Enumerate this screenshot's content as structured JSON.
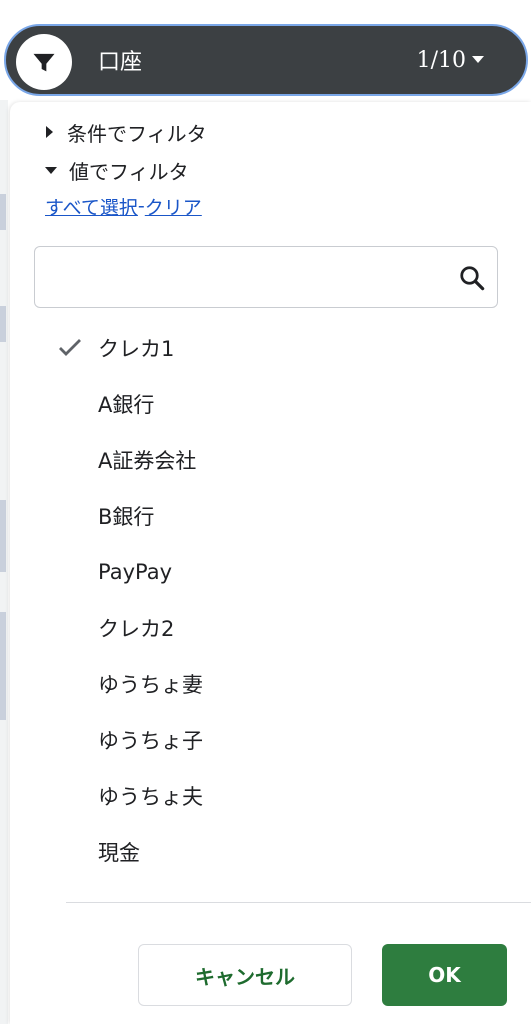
{
  "header": {
    "column_name": "口座",
    "counter": "1/10",
    "filter_icon": "filter-icon"
  },
  "filter_menu": {
    "by_condition_label": "条件でフィルタ",
    "by_value_label": "値でフィルタ",
    "select_all_label": "すべて選択",
    "separator": "-",
    "clear_label": "クリア",
    "search": {
      "value": "",
      "placeholder": "",
      "icon": "search-icon"
    },
    "values": [
      {
        "label": "クレカ1",
        "checked": true
      },
      {
        "label": "A銀行",
        "checked": false
      },
      {
        "label": "A証券会社",
        "checked": false
      },
      {
        "label": "B銀行",
        "checked": false
      },
      {
        "label": "PayPay",
        "checked": false
      },
      {
        "label": "クレカ2",
        "checked": false
      },
      {
        "label": "ゆうちょ妻",
        "checked": false
      },
      {
        "label": "ゆうちょ子",
        "checked": false
      },
      {
        "label": "ゆうちょ夫",
        "checked": false
      },
      {
        "label": "現金",
        "checked": false
      }
    ],
    "cancel_label": "キャンセル",
    "ok_label": "OK"
  },
  "colors": {
    "header_bg": "#3c4043",
    "header_border": "#7aa7e8",
    "link": "#1a56c8",
    "ok_bg": "#2e7d3f",
    "cancel_text": "#1e6b2e"
  }
}
